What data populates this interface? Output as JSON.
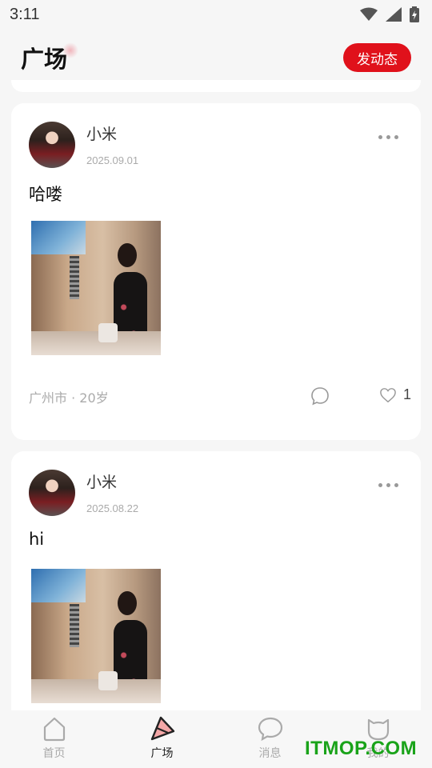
{
  "status_bar": {
    "time": "3:11"
  },
  "header": {
    "title": "广场",
    "post_button_label": "发动态"
  },
  "posts": [
    {
      "author": "小米",
      "date": "2025.09.01",
      "text": "哈喽",
      "meta": "广州市 · 20岁",
      "like_count": "1"
    },
    {
      "author": "小米",
      "date": "2025.08.22",
      "text": "hi"
    }
  ],
  "bottom_nav": {
    "items": [
      {
        "label": "首页",
        "icon": "home-icon"
      },
      {
        "label": "广场",
        "icon": "plaza-icon"
      },
      {
        "label": "消息",
        "icon": "message-icon"
      },
      {
        "label": "我的",
        "icon": "profile-icon"
      }
    ],
    "active_index": 1
  },
  "watermark": "ITMOP.COM",
  "colors": {
    "accent": "#e0111b",
    "background": "#f6f6f6",
    "card": "#ffffff"
  }
}
